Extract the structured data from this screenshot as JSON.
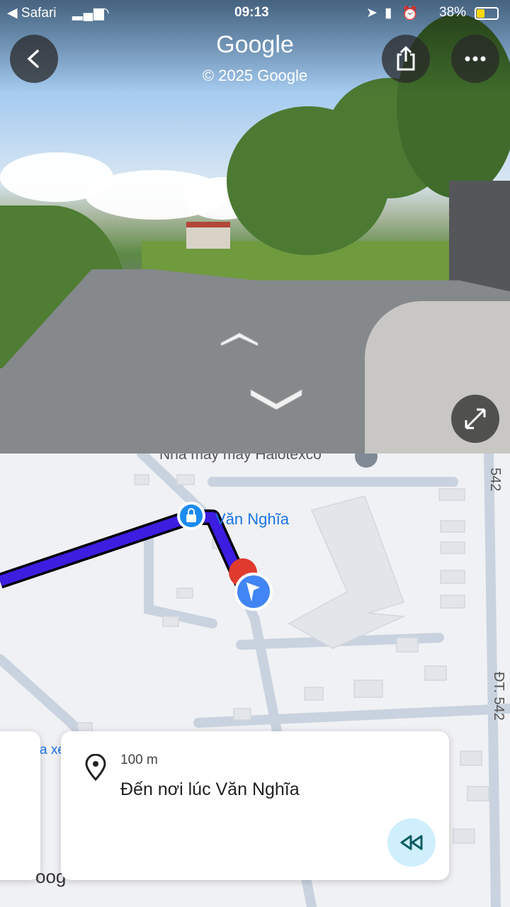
{
  "status_bar": {
    "back_app": "◀ Safari",
    "time": "09:13",
    "battery": "38%"
  },
  "header": {
    "title": "Google",
    "copyright": "© 2025 Google"
  },
  "map": {
    "poi_label": "Nhà máy may Halotexco",
    "place_label": "Văn Nghĩa",
    "road_label_top": "542",
    "road_label_side": "ĐT. 542",
    "partial_left_label": "a xe",
    "partial_bottom_label": "oog",
    "route_color": "#3d1de0"
  },
  "instruction": {
    "distance": "100 m",
    "text": "Đến nơi lúc Văn Nghĩa"
  },
  "icons": [
    "back-icon",
    "share-icon",
    "more-icon",
    "expand-icon",
    "place-pin-icon",
    "location-arrow-icon",
    "rewind-icon",
    "lock-bag-icon"
  ]
}
